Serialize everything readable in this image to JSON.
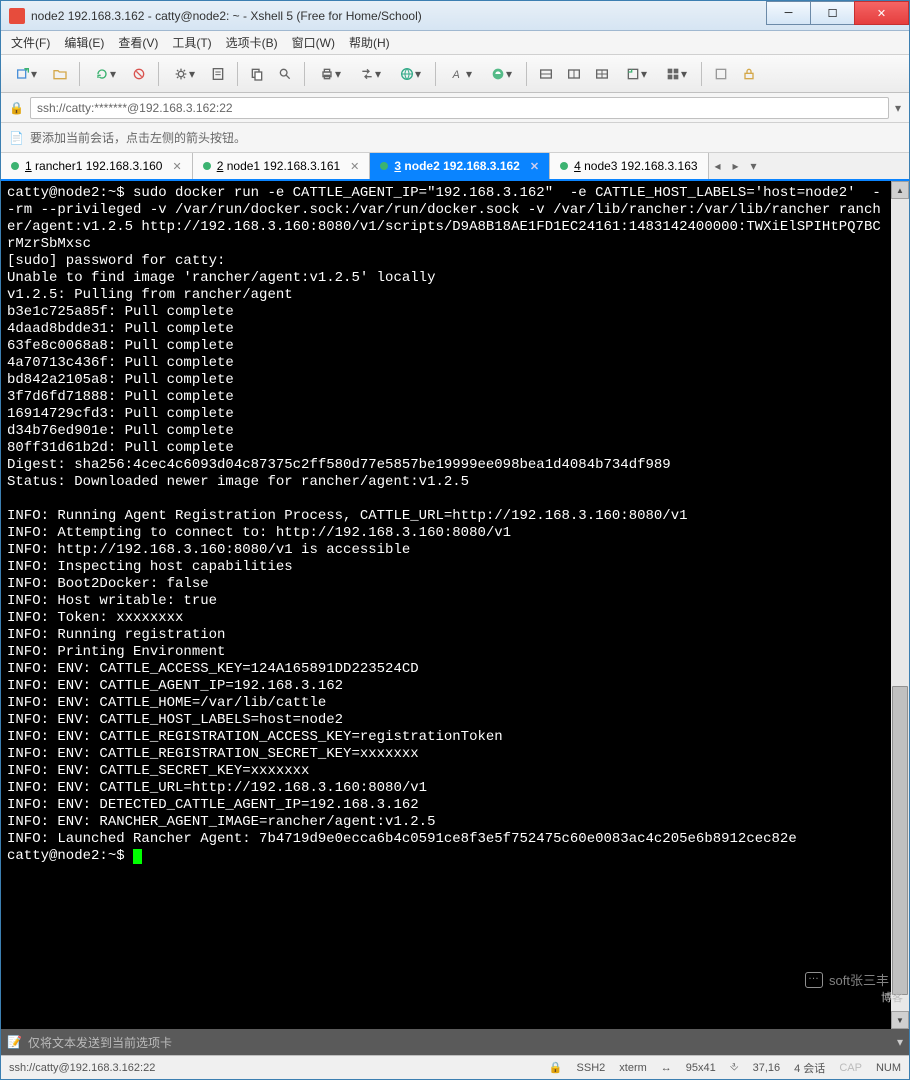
{
  "title": "node2 192.168.3.162 - catty@node2: ~ - Xshell 5 (Free for Home/School)",
  "menu": [
    "文件(F)",
    "编辑(E)",
    "查看(V)",
    "工具(T)",
    "选项卡(B)",
    "窗口(W)",
    "帮助(H)"
  ],
  "address": "ssh://catty:*******@192.168.3.162:22",
  "hint": "要添加当前会话，点击左侧的箭头按钮。",
  "tabs": [
    {
      "num": "1",
      "label": "rancher1 192.168.3.160",
      "active": false
    },
    {
      "num": "2",
      "label": "node1 192.168.3.161",
      "active": false
    },
    {
      "num": "3",
      "label": "node2 192.168.3.162",
      "active": true
    },
    {
      "num": "4",
      "label": "node3 192.168.3.163",
      "active": false
    }
  ],
  "prompt1": "catty@node2:~$ ",
  "cmd": "sudo docker run -e CATTLE_AGENT_IP=\"192.168.3.162\"  -e CATTLE_HOST_LABELS='host=node2'  --rm --privileged -v /var/run/docker.sock:/var/run/docker.sock -v /var/lib/rancher:/var/lib/rancher rancher/agent:v1.2.5 http://192.168.3.160:8080/v1/scripts/D9A8B18AE1FD1EC24161:1483142400000:TWXiElSPIHtPQ7BCrMzrSbMxsc",
  "out": "[sudo] password for catty:\nUnable to find image 'rancher/agent:v1.2.5' locally\nv1.2.5: Pulling from rancher/agent\nb3e1c725a85f: Pull complete\n4daad8bdde31: Pull complete\n63fe8c0068a8: Pull complete\n4a70713c436f: Pull complete\nbd842a2105a8: Pull complete\n3f7d6fd71888: Pull complete\n16914729cfd3: Pull complete\nd34b76ed901e: Pull complete\n80ff31d61b2d: Pull complete\nDigest: sha256:4cec4c6093d04c87375c2ff580d77e5857be19999ee098bea1d4084b734df989\nStatus: Downloaded newer image for rancher/agent:v1.2.5\n\nINFO: Running Agent Registration Process, CATTLE_URL=http://192.168.3.160:8080/v1\nINFO: Attempting to connect to: http://192.168.3.160:8080/v1\nINFO: http://192.168.3.160:8080/v1 is accessible\nINFO: Inspecting host capabilities\nINFO: Boot2Docker: false\nINFO: Host writable: true\nINFO: Token: xxxxxxxx\nINFO: Running registration\nINFO: Printing Environment\nINFO: ENV: CATTLE_ACCESS_KEY=124A165891DD223524CD\nINFO: ENV: CATTLE_AGENT_IP=192.168.3.162\nINFO: ENV: CATTLE_HOME=/var/lib/cattle\nINFO: ENV: CATTLE_HOST_LABELS=host=node2\nINFO: ENV: CATTLE_REGISTRATION_ACCESS_KEY=registrationToken\nINFO: ENV: CATTLE_REGISTRATION_SECRET_KEY=xxxxxxx\nINFO: ENV: CATTLE_SECRET_KEY=xxxxxxx\nINFO: ENV: CATTLE_URL=http://192.168.3.160:8080/v1\nINFO: ENV: DETECTED_CATTLE_AGENT_IP=192.168.3.162\nINFO: ENV: RANCHER_AGENT_IMAGE=rancher/agent:v1.2.5\nINFO: Launched Rancher Agent: 7b4719d9e0ecca6b4c0591ce8f3e5f752475c60e0083ac4c205e6b8912cec82e",
  "prompt2": "catty@node2:~$ ",
  "inputbar_placeholder": "仅将文本发送到当前选项卡",
  "status": {
    "addr": "ssh://catty@192.168.3.162:22",
    "proto": "SSH2",
    "term": "xterm",
    "size": "95x41",
    "pos": "37,16",
    "sessions": "4 会话",
    "caps": "CAP",
    "num": "NUM"
  },
  "watermark": "soft张三丰",
  "watermark2": "博客"
}
